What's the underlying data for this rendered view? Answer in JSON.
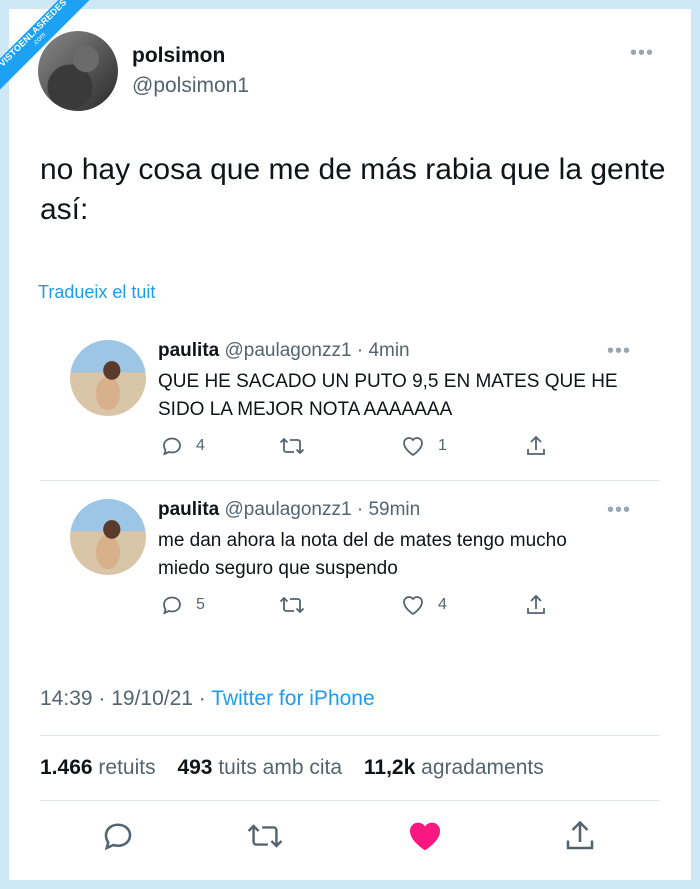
{
  "watermark": {
    "line1": "VISTOENLASREDES",
    "line2": ".com"
  },
  "author": {
    "name": "polsimon",
    "handle": "@polsimon1"
  },
  "tweet": {
    "text": "no hay cosa que me de más rabia que la gente así:",
    "translate_link": "Tradueix el tuit"
  },
  "quoted": [
    {
      "name": "paulita",
      "handle_time": "@paulagonzz1 · 4min",
      "text": "QUE HE SACADO UN PUTO 9,5 EN MATES QUE HE SIDO LA MEJOR NOTA AAAAAAA",
      "replies": "4",
      "retweets": "",
      "likes": "1"
    },
    {
      "name": "paulita",
      "handle_time": "@paulagonzz1 · 59min",
      "text": "me dan ahora la nota del de mates tengo mucho miedo seguro que suspendo",
      "replies": "5",
      "retweets": "",
      "likes": "4"
    }
  ],
  "meta": {
    "time": "14:39 · 19/10/21 · ",
    "source": "Twitter for iPhone"
  },
  "stats": {
    "retweets_count": "1.466",
    "retweets_label": "retuits",
    "quotes_count": "493",
    "quotes_label": "tuits amb cita",
    "likes_count": "11,2k",
    "likes_label": "agradaments"
  },
  "colors": {
    "accent": "#1d9bf0",
    "like": "#f91880",
    "frame": "#cfe8f7"
  },
  "icons": [
    "reply-icon",
    "retweet-icon",
    "like-icon",
    "share-icon",
    "more-icon"
  ]
}
